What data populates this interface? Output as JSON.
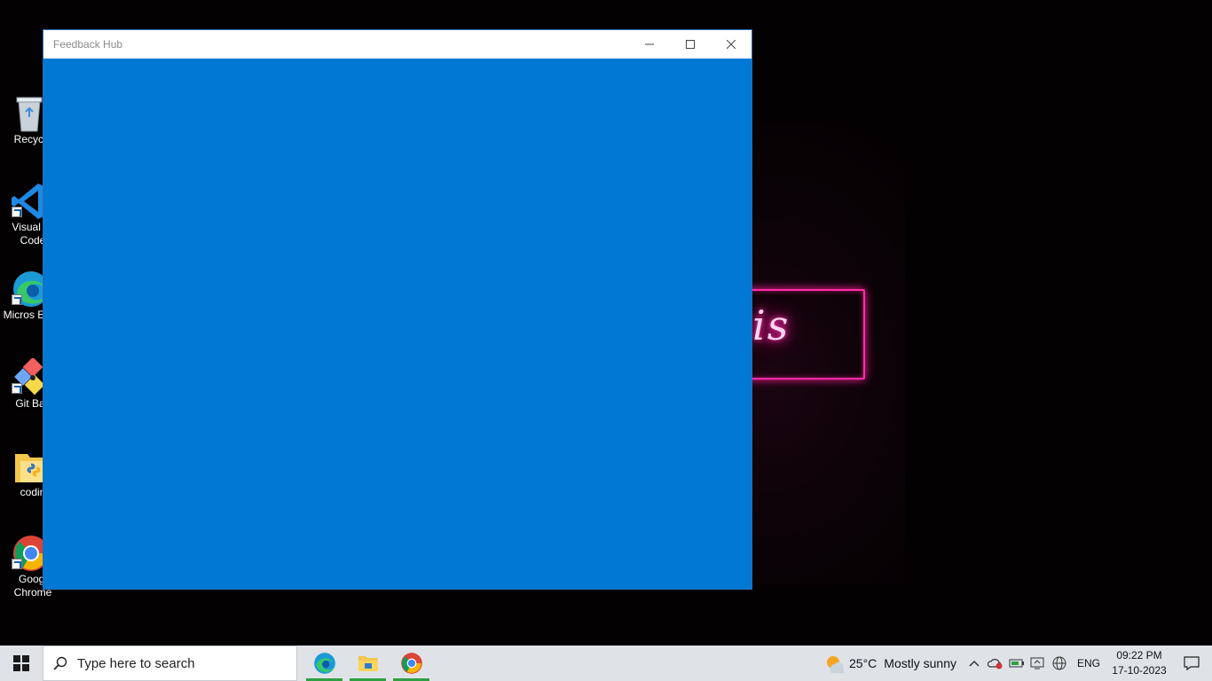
{
  "window": {
    "title": "Feedback Hub",
    "controls": {
      "minimize": "minimize-icon",
      "maximize": "maximize-icon",
      "close": "close-icon"
    }
  },
  "wallpaper": {
    "neon_text": "is"
  },
  "desktop": {
    "icons": [
      {
        "label": "Recycle",
        "icon": "recycle-bin-icon"
      },
      {
        "label": "Visual St Code",
        "icon": "vscode-icon"
      },
      {
        "label": "Micros Edge",
        "icon": "edge-icon"
      },
      {
        "label": "Git Bas",
        "icon": "git-bash-icon"
      },
      {
        "label": "codin",
        "icon": "folder-icon"
      },
      {
        "label": "Googl Chrome",
        "icon": "chrome-icon"
      }
    ]
  },
  "taskbar": {
    "search_placeholder": "Type here to search",
    "pinned": [
      "edge-icon",
      "file-explorer-icon",
      "chrome-icon"
    ],
    "weather": {
      "temp": "25°C",
      "condition": "Mostly sunny"
    },
    "language": "ENG",
    "time": "09:22 PM",
    "date": "17-10-2023"
  },
  "colors": {
    "app_background": "#0078d4",
    "taskbar": "#dfe3e8",
    "active_indicator": "#2ea043"
  }
}
